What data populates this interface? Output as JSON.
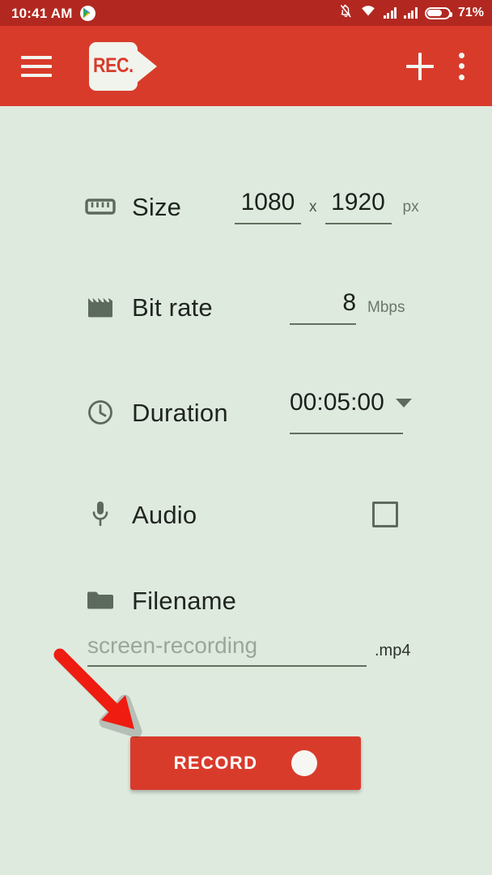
{
  "status_bar": {
    "time": "10:41 AM",
    "playstore_icon": "playstore-icon",
    "notifications_off_icon": "bell-off-icon",
    "wifi_icon": "wifi-icon",
    "signal_icon_1": "signal-bars-icon",
    "signal_icon_2": "signal-bars-icon",
    "battery_icon": "battery-icon",
    "battery_percent": "71%",
    "battery_level": 71,
    "background_color": "#b22820"
  },
  "app_bar": {
    "menu_icon": "hamburger-menu-icon",
    "logo_text": "REC.",
    "add_icon": "plus-icon",
    "overflow_icon": "overflow-menu-icon",
    "background_color": "#d93b2b"
  },
  "settings": {
    "size": {
      "icon": "ruler-icon",
      "label": "Size",
      "width_value": "1080",
      "width_placeholder": "1080",
      "separator": "x",
      "height_value": "1920",
      "height_placeholder": "1920",
      "unit": "px"
    },
    "bitrate": {
      "icon": "clapperboard-icon",
      "label": "Bit rate",
      "value": "8",
      "placeholder": "8",
      "unit": "Mbps"
    },
    "duration": {
      "icon": "clock-icon",
      "label": "Duration",
      "value": "00:05:00",
      "dropdown_icon": "chevron-down-icon"
    },
    "audio": {
      "icon": "microphone-icon",
      "label": "Audio",
      "checked": false
    },
    "filename": {
      "icon": "folder-icon",
      "label": "Filename",
      "value": "",
      "placeholder": "screen-recording",
      "extension": ".mp4"
    }
  },
  "record_button": {
    "label": "RECORD",
    "dot_icon": "record-dot-icon",
    "color": "#d93b2b"
  },
  "annotation": {
    "arrow_color": "#ee1c11",
    "arrow_target": "record-button"
  },
  "theme": {
    "background": "#dfeadf",
    "accent_red": "#d93b2b",
    "icon_gray": "#5c6a5d",
    "text_dark": "#1c211c",
    "placeholder_gray": "#9aa69a"
  }
}
